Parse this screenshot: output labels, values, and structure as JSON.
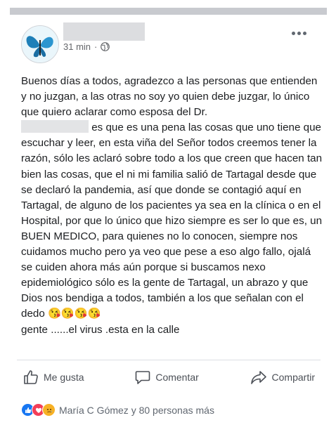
{
  "post": {
    "time": "31 min",
    "separator": "·",
    "text_part1": "Buenos días a todos, agradezco a las personas que entienden y no juzgan, a las otras no soy yo quien debe juzgar, lo único que quiero aclarar como esposa del Dr.\n",
    "text_part2": " es que es una pena las cosas que uno tiene que escuchar y leer, en esta viña del Señor todos creemos tener la razón, sólo les aclaró sobre todo a los que creen que hacen tan bien las cosas, que el ni mi familia salió de Tartagal desde que se declaró la pandemia, así que donde se contagió aquí en Tartagal, de alguno de los pacientes ya sea en la clínica o en el Hospital, por que lo único que hizo siempre es ser lo que es, un BUEN MEDICO, para quienes no lo conocen, siempre nos cuidamos mucho pero ya veo que pese a eso algo fallo, ojalá se cuiden ahora más aún porque si buscamos nexo epidemiológico sólo es la gente de Tartagal, un abrazo y que Dios nos bendiga a todos, también a los que señalan con el dedo ",
    "emojis": "😘😘😘😘",
    "text_part3": "\ngente ......el virus .esta en la calle"
  },
  "actions": {
    "like": "Me gusta",
    "comment": "Comentar",
    "share": "Compartir"
  },
  "reactions": {
    "icons": [
      "like-icon",
      "love-icon",
      "sad-icon"
    ],
    "summary": "María C Gómez y 80 personas más"
  },
  "colors": {
    "like": "#1877f2",
    "love": "#f33e58",
    "sad": "#f7b125"
  }
}
